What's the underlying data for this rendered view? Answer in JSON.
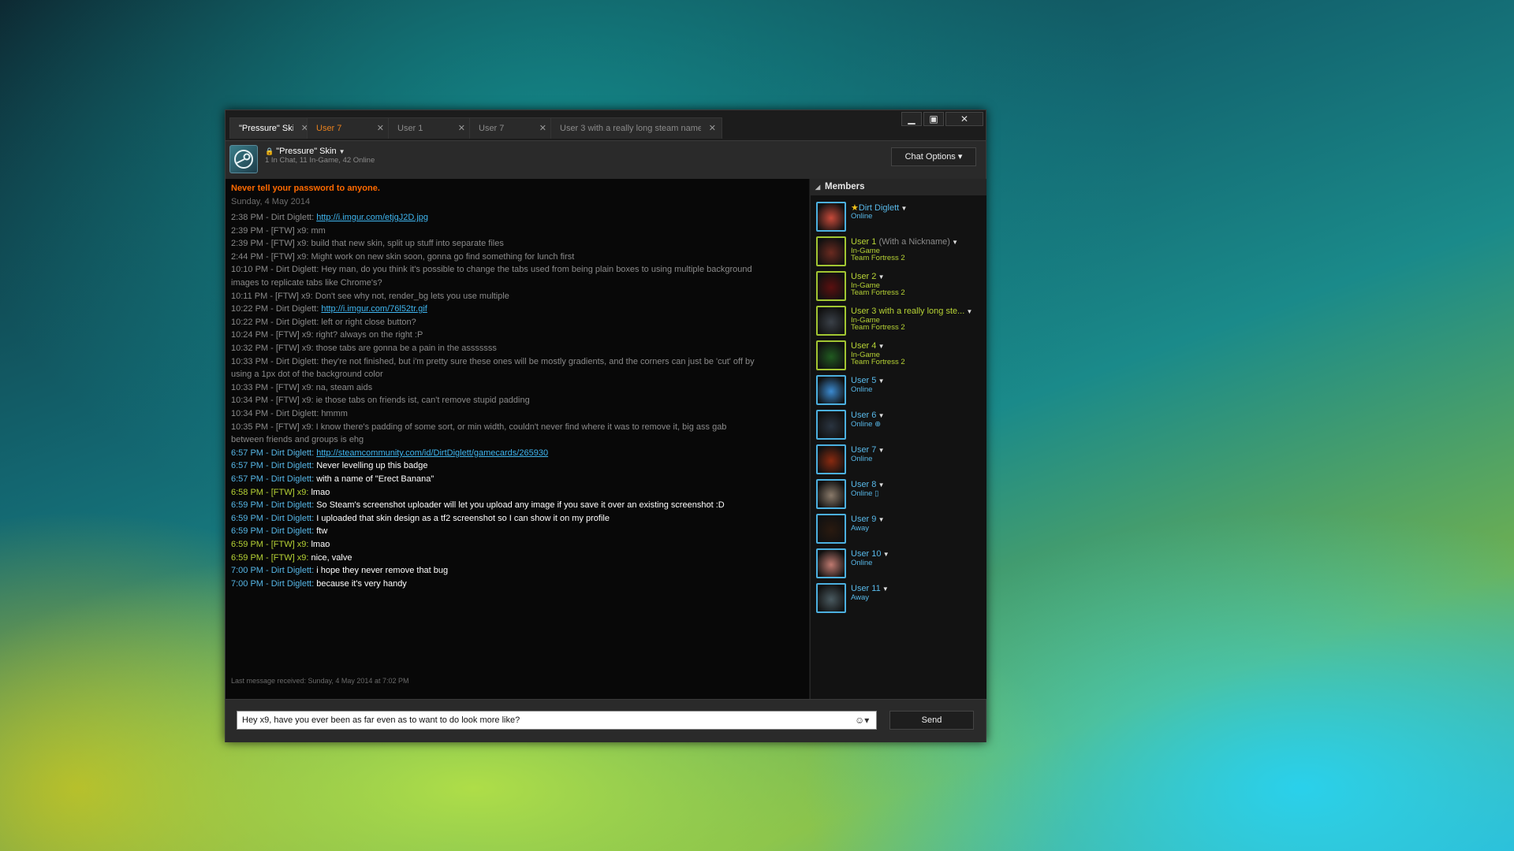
{
  "tabs": [
    {
      "label": "\"Pressure\" Skin",
      "state": "active"
    },
    {
      "label": "User 7",
      "state": "unread"
    },
    {
      "label": "User 1",
      "state": "normal"
    },
    {
      "label": "User 7",
      "state": "normal"
    },
    {
      "label": "User 3 with a really long steam name",
      "state": "normal"
    }
  ],
  "window_controls": {
    "minimize": "▁",
    "maximize": "▣",
    "close": "✕"
  },
  "group": {
    "name": "\"Pressure\" Skin",
    "subtitle": "1 In Chat, 11 In-Game, 42 Online"
  },
  "chat_options_label": "Chat Options ▾",
  "chat": {
    "warning": "Never tell your password to anyone.",
    "date": "Sunday, 4 May 2014",
    "old": [
      {
        "prefix": "2:38 PM - Dirt Diglett: ",
        "link": "http://i.imgur.com/etjgJ2D.jpg"
      },
      {
        "prefix": "2:39 PM - [FTW] x9: mm"
      },
      {
        "prefix": "2:39 PM - [FTW] x9: build that new skin, split up stuff into separate files"
      },
      {
        "prefix": "2:44 PM - [FTW] x9: Might work on new skin soon, gonna go find something for lunch first"
      },
      {
        "prefix": "10:10 PM - Dirt Diglett: Hey man, do you think it's possible to change the tabs used from being plain boxes to using multiple background"
      },
      {
        "prefix": " images to replicate tabs like Chrome's?"
      },
      {
        "prefix": "10:11 PM - [FTW] x9: Don't see why not, render_bg lets you use multiple"
      },
      {
        "prefix": "10:22 PM - Dirt Diglett: ",
        "link": "http://i.imgur.com/76l52tr.gif"
      },
      {
        "prefix": "10:22 PM - Dirt Diglett: left or right close button?"
      },
      {
        "prefix": "10:24 PM - [FTW] x9: right? always on the right :P"
      },
      {
        "prefix": "10:32 PM - [FTW] x9: those tabs are gonna be a pain in the asssssss"
      },
      {
        "prefix": "10:33 PM - Dirt Diglett: they're not finished, but i'm pretty sure these ones will be mostly gradients, and the corners can just be 'cut' off by"
      },
      {
        "prefix": "using a 1px dot of the background color"
      },
      {
        "prefix": "10:33 PM - [FTW] x9: na, steam aids"
      },
      {
        "prefix": "10:34 PM - [FTW] x9: ie those tabs on friends ist, can't remove stupid padding"
      },
      {
        "prefix": "10:34 PM - Dirt Diglett: hmmm"
      },
      {
        "prefix": "10:35 PM - [FTW] x9: I know there's padding of some sort, or min width, couldn't never find where it was to remove it, big ass gab"
      },
      {
        "prefix": "between friends and groups is ehg"
      }
    ],
    "new": [
      {
        "ts": "6:57 PM - Dirt Diglett:",
        "color": "blue",
        "link": "http://steamcommunity.com/id/DirtDiglett/gamecards/265930"
      },
      {
        "ts": "6:57 PM - Dirt Diglett:",
        "color": "blue",
        "text": "Never levelling up this badge"
      },
      {
        "ts": "6:57 PM - Dirt Diglett:",
        "color": "blue",
        "text": "with a name of \"Erect Banana\""
      },
      {
        "ts": "6:58 PM - [FTW] x9:",
        "color": "green",
        "text": "lmao"
      },
      {
        "ts": "6:59 PM - Dirt Diglett:",
        "color": "blue",
        "text": "So Steam's screenshot uploader will let you upload any image if you save it over an existing screenshot :D"
      },
      {
        "ts": "6:59 PM - Dirt Diglett:",
        "color": "blue",
        "text": "I uploaded that skin design as a tf2 screenshot so I can show it on my profile"
      },
      {
        "ts": "6:59 PM - Dirt Diglett:",
        "color": "blue",
        "text": "ftw"
      },
      {
        "ts": "6:59 PM - [FTW] x9:",
        "color": "green",
        "text": "lmao"
      },
      {
        "ts": "6:59 PM - [FTW] x9:",
        "color": "green",
        "text": "nice, valve"
      },
      {
        "ts": "7:00 PM - Dirt Diglett:",
        "color": "blue",
        "text": "i hope they never remove that bug"
      },
      {
        "ts": "7:00 PM - Dirt Diglett:",
        "color": "blue",
        "text": "because it's very handy"
      }
    ],
    "last_received": "Last message received: Sunday, 4 May 2014 at 7:02 PM"
  },
  "members_title": "Members",
  "members": [
    {
      "name": "Dirt Diglett",
      "nick": "",
      "status": "Online",
      "game": "",
      "color": "blue",
      "star": true
    },
    {
      "name": "User 1",
      "nick": " (With a Nickname)",
      "status": "In-Game",
      "game": "Team Fortress 2",
      "color": "green"
    },
    {
      "name": "User 2",
      "nick": "",
      "status": "In-Game",
      "game": "Team Fortress 2",
      "color": "green"
    },
    {
      "name": "User 3 with a really long ste...",
      "nick": "",
      "status": "In-Game",
      "game": "Team Fortress 2",
      "color": "green"
    },
    {
      "name": "User 4",
      "nick": "",
      "status": "In-Game",
      "game": "Team Fortress 2",
      "color": "green"
    },
    {
      "name": "User 5",
      "nick": "",
      "status": "Online",
      "game": "",
      "color": "blue"
    },
    {
      "name": "User 6",
      "nick": "",
      "status": "Online ⊕",
      "game": "",
      "color": "blue"
    },
    {
      "name": "User 7",
      "nick": "",
      "status": "Online",
      "game": "",
      "color": "blue"
    },
    {
      "name": "User 8",
      "nick": "",
      "status": "Online ▯",
      "game": "",
      "color": "blue"
    },
    {
      "name": "User 9",
      "nick": "",
      "status": "Away",
      "game": "",
      "color": "blue"
    },
    {
      "name": "User 10",
      "nick": "",
      "status": "Online",
      "game": "",
      "color": "blue"
    },
    {
      "name": "User 11",
      "nick": "",
      "status": "Away",
      "game": "",
      "color": "blue"
    }
  ],
  "input": {
    "value": "Hey x9, have you ever been as far even as to want to do look more like?",
    "emoji_icon": "☺▾"
  },
  "send_label": "Send",
  "colors": {
    "blue": "#58b8e8",
    "green": "#b6d235",
    "warning": "#ff6a00",
    "unread_tab": "#e8801d"
  }
}
